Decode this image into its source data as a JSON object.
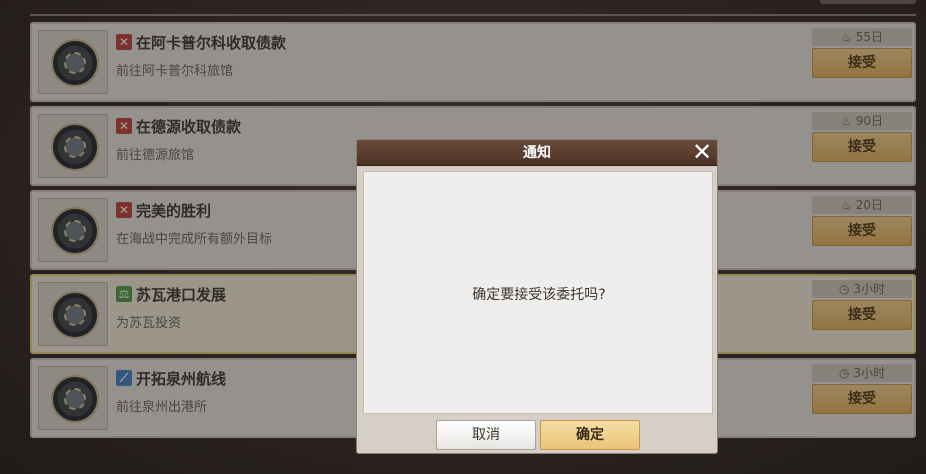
{
  "quests": [
    {
      "icon": "✕",
      "icon_color": "red",
      "icon_name": "crossed-swords-icon",
      "title": "在阿卡普尔科收取债款",
      "sub": "前往阿卡普尔科旅馆",
      "time_icon": "♨",
      "time": "55日",
      "accept": "接受"
    },
    {
      "icon": "✕",
      "icon_color": "red",
      "icon_name": "crossed-swords-icon",
      "title": "在德源收取债款",
      "sub": "前往德源旅馆",
      "time_icon": "♨",
      "time": "90日",
      "accept": "接受"
    },
    {
      "icon": "✕",
      "icon_color": "red",
      "icon_name": "crossed-swords-icon",
      "title": "完美的胜利",
      "sub": "在海战中完成所有额外目标",
      "time_icon": "♨",
      "time": "20日",
      "accept": "接受"
    },
    {
      "icon": "⚖",
      "icon_color": "green",
      "icon_name": "scales-icon",
      "title": "苏瓦港口发展",
      "sub": "为苏瓦投资",
      "time_icon": "◷",
      "time": "3小时",
      "accept": "接受"
    },
    {
      "icon": "⟋",
      "icon_color": "blue",
      "icon_name": "route-icon",
      "title": "开拓泉州航线",
      "sub": "前往泉州出港所",
      "time_icon": "◷",
      "time": "3小时",
      "accept": "接受"
    }
  ],
  "dialog": {
    "title": "通知",
    "close": "✕",
    "message": "确定要接受该委托吗?",
    "cancel": "取消",
    "confirm": "确定"
  }
}
